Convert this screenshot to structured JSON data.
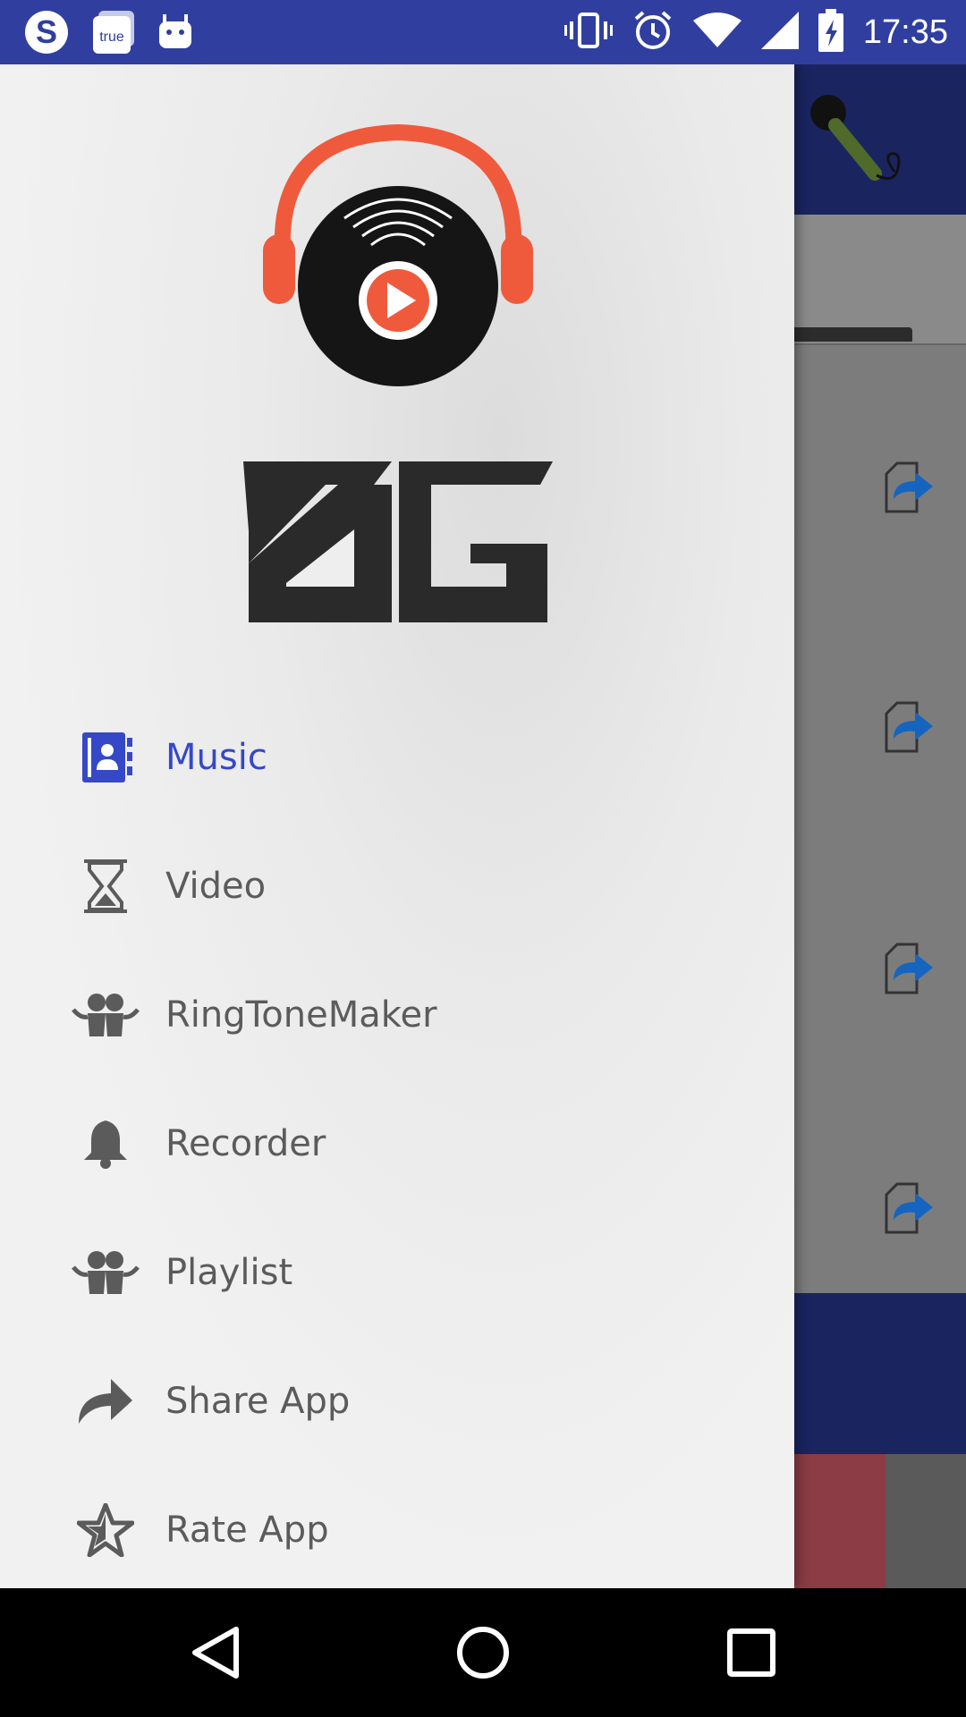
{
  "status_bar": {
    "time": "17:35",
    "left_icons": [
      "skype-icon",
      "true-app-icon",
      "android-icon"
    ],
    "right_icons": [
      "vibrate-icon",
      "alarm-icon",
      "wifi-icon",
      "signal-icon",
      "battery-charging-icon"
    ],
    "true_label": "true"
  },
  "drawer": {
    "menu": [
      {
        "label": "Music",
        "icon": "contacts-icon",
        "active": true
      },
      {
        "label": "Video",
        "icon": "hourglass-icon",
        "active": false
      },
      {
        "label": "RingToneMaker",
        "icon": "people-icon",
        "active": false
      },
      {
        "label": "Recorder",
        "icon": "bell-icon",
        "active": false
      },
      {
        "label": "Playlist",
        "icon": "people-icon",
        "active": false
      },
      {
        "label": "Share App",
        "icon": "share-arrow-icon",
        "active": false
      },
      {
        "label": "Rate App",
        "icon": "star-icon",
        "active": false
      }
    ]
  },
  "colors": {
    "status_bar": "#303f9f",
    "active": "#3548c8",
    "inactive": "#5b5b5b",
    "headphones": "#f05a3c"
  },
  "nav": {
    "icons": [
      "back-icon",
      "home-icon",
      "recents-icon"
    ]
  }
}
